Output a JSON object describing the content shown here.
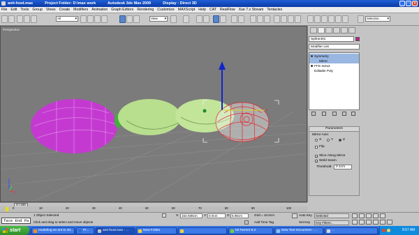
{
  "titlebar": {
    "file": "anti-food.max",
    "project": "Project Folder: D:\\max work",
    "app": "Autodesk 3ds Max  2009",
    "display": "Display : Direct 3D"
  },
  "menu": [
    "File",
    "Edit",
    "Tools",
    "Group",
    "Views",
    "Create",
    "Modifiers",
    "Animation",
    "Graph Editors",
    "Rendering",
    "Customize",
    "MAXScript",
    "Help",
    "CAT",
    "RealFlow",
    "Xue 7.x Stream",
    "Tentacles"
  ],
  "toolbar": {
    "selection_filter": "All",
    "ref_coord": "View",
    "named_selection": "Selection..."
  },
  "viewport": {
    "label": "Perspective"
  },
  "command_panel": {
    "object_name": "Spline401",
    "modifier_list": "Modifier List",
    "stack": [
      "Symmetry",
      "Mirror",
      "FFD 3x3x3",
      "Editable Poly"
    ],
    "rollout_title": "Parameters",
    "mirror_axis_label": "Mirror Axis:",
    "axes": [
      "X",
      "Y",
      "Z"
    ],
    "flip_label": "Flip",
    "slice_label": "Slice Along Mirror",
    "weld_label": "Weld Seam",
    "threshold_label": "Threshold:",
    "threshold_value": "0.1cm"
  },
  "timeline": {
    "frame": "0 / 100",
    "ticks": [
      "0",
      "10",
      "20",
      "30",
      "40",
      "50",
      "60",
      "70",
      "80",
      "90",
      "100"
    ]
  },
  "status": {
    "selected": "1 Object Selected",
    "prompt": "Click and drag to select and move objects",
    "x_label": "X:",
    "x": "152.938cm",
    "y_label": "Y:",
    "y": "0.0cm",
    "z_label": "Z:",
    "z": "5.96cm",
    "grid": "Grid = 10.0cm",
    "add_time_tag": "Add Time Tag",
    "auto_key": "Auto Key",
    "key_mode": "Selected",
    "set_key": "Set Key",
    "key_filters": "Key Filters..."
  },
  "ime": "face End Pa",
  "taskbar": {
    "start": "start",
    "tasks": [
      "modeling an ant in 3d...",
      "Pr...",
      "anti-food.max - ...",
      "New Folder",
      "",
      "bit Torrent 6.2",
      "New Text Document - ...",
      "..."
    ],
    "clock": "8:57 AM"
  },
  "colors": {
    "purple_fruit": "#c43ad1",
    "green_body": "#b8df8e",
    "red_wire": "#e0282a",
    "viewport_bg": "#7b7b7b"
  }
}
